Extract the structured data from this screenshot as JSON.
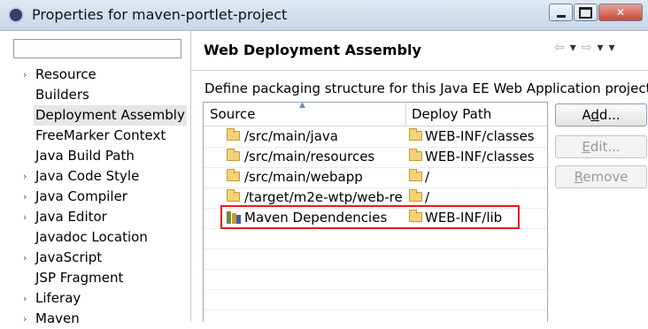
{
  "window": {
    "title": "Properties for maven-portlet-project",
    "minimize": "",
    "maximize": "",
    "close": "✕"
  },
  "sidebar": {
    "filter_placeholder": "",
    "items": [
      {
        "label": "Resource",
        "arrow": "›"
      },
      {
        "label": "Builders",
        "arrow": ""
      },
      {
        "label": "Deployment Assembly",
        "arrow": ""
      },
      {
        "label": "FreeMarker Context",
        "arrow": ""
      },
      {
        "label": "Java Build Path",
        "arrow": ""
      },
      {
        "label": "Java Code Style",
        "arrow": "›"
      },
      {
        "label": "Java Compiler",
        "arrow": "›"
      },
      {
        "label": "Java Editor",
        "arrow": "›"
      },
      {
        "label": "Javadoc Location",
        "arrow": ""
      },
      {
        "label": "JavaScript",
        "arrow": "›"
      },
      {
        "label": "JSP Fragment",
        "arrow": ""
      },
      {
        "label": "Liferay",
        "arrow": "›"
      },
      {
        "label": "Maven",
        "arrow": "›"
      }
    ]
  },
  "page": {
    "title": "Web Deployment Assembly",
    "description": "Define packaging structure for this Java EE Web Application project.",
    "nav_back": "⇦",
    "nav_forward": "⇨",
    "nav_menu": "▾"
  },
  "table": {
    "headers": {
      "source": "Source",
      "deploy": "Deploy Path",
      "sort": "▲"
    },
    "rows": [
      {
        "source": "/src/main/java",
        "deploy": "WEB-INF/classes",
        "icon": "folder-icon"
      },
      {
        "source": "/src/main/resources",
        "deploy": "WEB-INF/classes",
        "icon": "folder-icon"
      },
      {
        "source": "/src/main/webapp",
        "deploy": "/",
        "icon": "folder-icon"
      },
      {
        "source": "/target/m2e-wtp/web-re",
        "deploy": "/",
        "icon": "folder-icon"
      },
      {
        "source": "Maven Dependencies",
        "deploy": "WEB-INF/lib",
        "icon": "library-icon"
      }
    ]
  },
  "buttons": {
    "add_pre": "A",
    "add_mn": "d",
    "add_post": "d...",
    "edit_pre": "",
    "edit_mn": "E",
    "edit_post": "dit...",
    "remove_pre": "",
    "remove_mn": "R",
    "remove_post": "emove"
  },
  "colors": {
    "highlight": "#e8191c",
    "selection": "#e6e6e6"
  }
}
